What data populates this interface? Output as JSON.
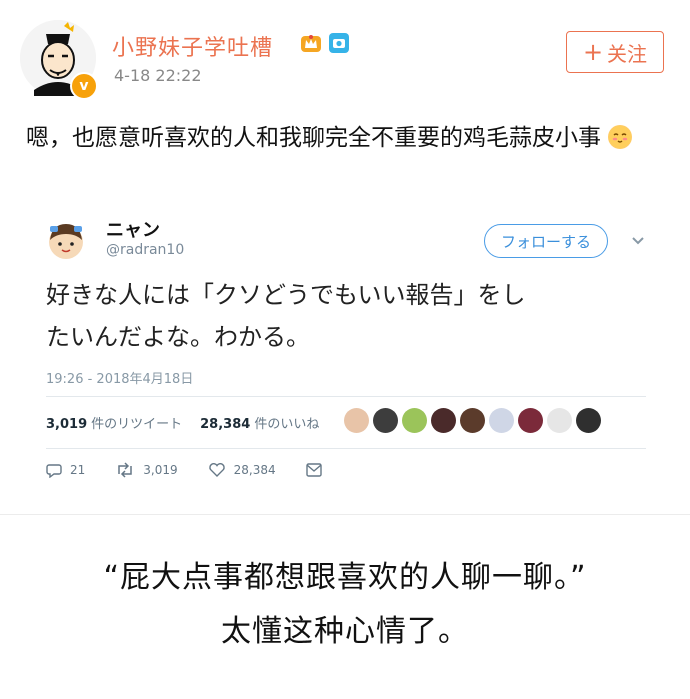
{
  "post": {
    "username": "小野妹子学吐槽",
    "timestamp": "4-18 22:22",
    "follow_label": "关注",
    "text": "嗯，也愿意听喜欢的人和我聊完全不重要的鸡毛蒜皮小事",
    "brand_color": "#eb7350"
  },
  "tweet": {
    "name": "ニャン",
    "handle": "@radran10",
    "follow_label": "フォローする",
    "text_line1": "好きな人には「クソどうでもいい報告」をし",
    "text_line2": "たいんだよな。わかる。",
    "date": "19:26 - 2018年4月18日",
    "retweets_count": "3,019",
    "retweets_label": "件のリツイート",
    "likes_count": "28,384",
    "likes_label": "件のいいね",
    "reply_count": "21",
    "retweet_action_count": "3,019",
    "like_action_count": "28,384",
    "accent_color": "#3a8fdb"
  },
  "caption": {
    "line1": "“屁大点事都想跟喜欢的人聊一聊。”",
    "line2": "太懂这种心情了。"
  }
}
